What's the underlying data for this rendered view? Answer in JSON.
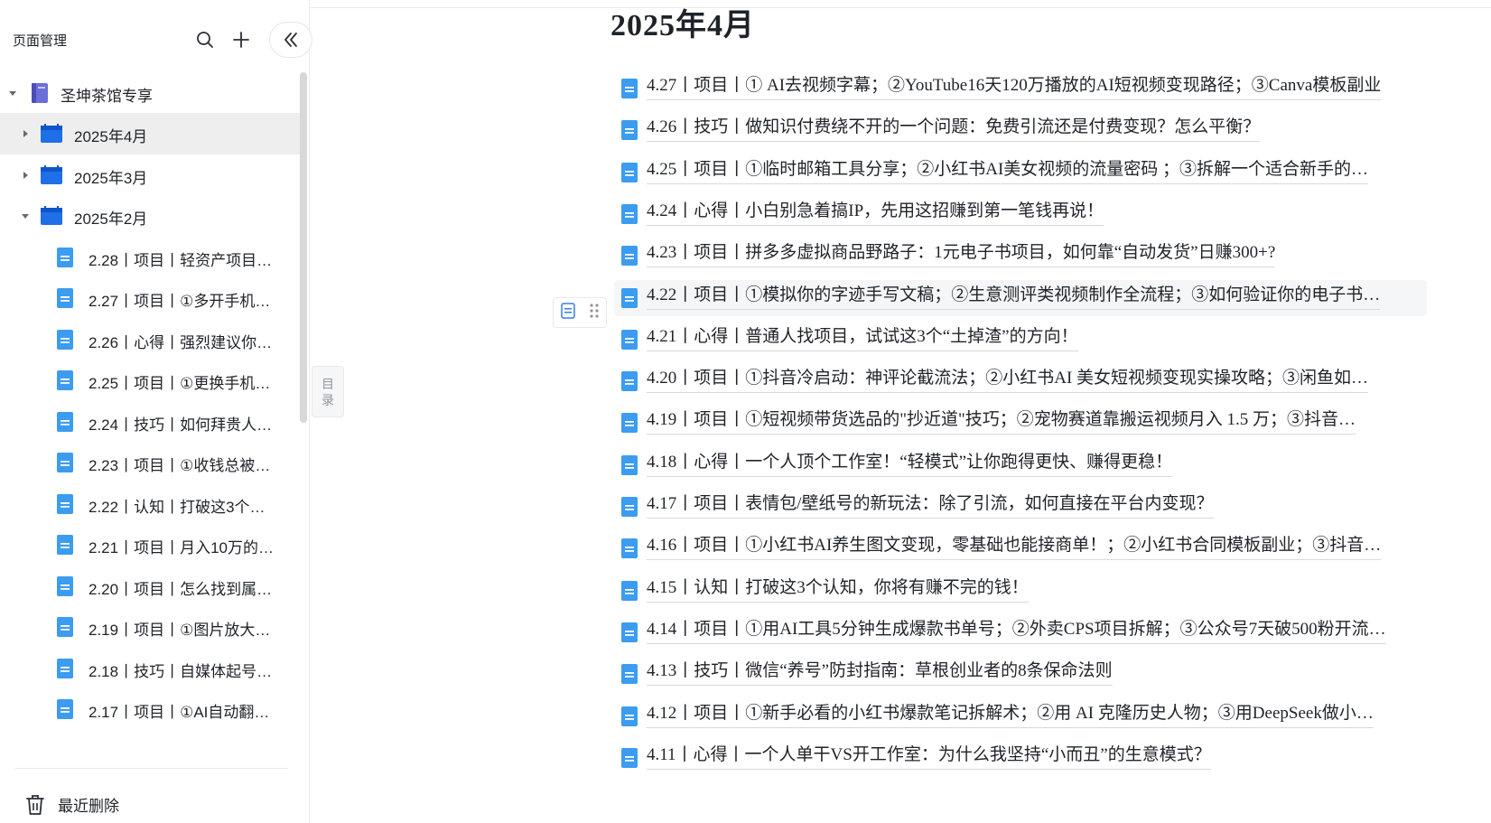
{
  "sidebar": {
    "title": "页面管理",
    "root": {
      "label": "圣坤茶馆专享"
    },
    "folders": [
      {
        "label": "2025年4月"
      },
      {
        "label": "2025年3月"
      },
      {
        "label": "2025年2月"
      }
    ],
    "items": [
      {
        "label": "2.28丨项目丨轻资产项目…"
      },
      {
        "label": "2.27丨项目丨①多开手机…"
      },
      {
        "label": "2.26丨心得丨强烈建议你…"
      },
      {
        "label": "2.25丨项目丨①更换手机…"
      },
      {
        "label": "2.24丨技巧丨如何拜贵人…"
      },
      {
        "label": "2.23丨项目丨①收钱总被…"
      },
      {
        "label": "2.22丨认知丨打破这3个…"
      },
      {
        "label": "2.21丨项目丨月入10万的…"
      },
      {
        "label": "2.20丨项目丨怎么找到属…"
      },
      {
        "label": "2.19丨项目丨①图片放大…"
      },
      {
        "label": "2.18丨技巧丨自媒体起号…"
      },
      {
        "label": "2.17丨项目丨①AI自动翻…"
      }
    ],
    "trash_label": "最近删除",
    "toc_label_1": "目",
    "toc_label_2": "录"
  },
  "main": {
    "title": "2025年4月",
    "docs": [
      {
        "text": "4.27丨项目丨① AI去视频字幕；②YouTube16天120万播放的AI短视频变现路径；③Canva模板副业"
      },
      {
        "text": "4.26丨技巧丨做知识付费绕不开的一个问题：免费引流还是付费变现？怎么平衡？"
      },
      {
        "text": "4.25丨项目丨①临时邮箱工具分享；②小红书AI美女视频的流量密码 ；③拆解一个适合新手的…"
      },
      {
        "text": "4.24丨心得丨小白别急着搞IP，先用这招赚到第一笔钱再说！"
      },
      {
        "text": "4.23丨项目丨拼多多虚拟商品野路子：1元电子书项目，如何靠“自动发货”日赚300+?"
      },
      {
        "text": "4.22丨项目丨①模拟你的字迹手写文稿；②生意测评类视频制作全流程；③如何验证你的电子书…"
      },
      {
        "text": "4.21丨心得丨普通人找项目，试试这3个“土掉渣”的方向！"
      },
      {
        "text": "4.20丨项目丨①抖音冷启动：神评论截流法；②小红书AI 美女短视频变现实操攻略；③闲鱼如…"
      },
      {
        "text": "4.19丨项目丨①短视频带货选品的\"抄近道\"技巧；②宠物赛道靠搬运视频月入 1.5 万；③抖音…"
      },
      {
        "text": "4.18丨心得丨一个人顶个工作室！“轻模式”让你跑得更快、赚得更稳！"
      },
      {
        "text": "4.17丨项目丨表情包/壁纸号的新玩法：除了引流，如何直接在平台内变现？"
      },
      {
        "text": "4.16丨项目丨①小红书AI养生图文变现，零基础也能接商单！；②小红书合同模板副业；③抖音…"
      },
      {
        "text": "4.15丨认知丨打破这3个认知，你将有赚不完的钱！"
      },
      {
        "text": "4.14丨项目丨①用AI工具5分钟生成爆款书单号；②外卖CPS项目拆解；③公众号7天破500粉开流…"
      },
      {
        "text": "4.13丨技巧丨微信“养号”防封指南：草根创业者的8条保命法则"
      },
      {
        "text": "4.12丨项目丨①新手必看的小红书爆款笔记拆解术；②用 AI 克隆历史人物；③用DeepSeek做小…"
      },
      {
        "text": "4.11丨心得丨一个人单干VS开工作室：为什么我坚持“小而丑”的生意模式？"
      }
    ]
  },
  "colors": {
    "doc_icon_blue": "#3b9cf0",
    "folder_blue": "#1e6fe8",
    "book_purple": "#6d6fd9",
    "selected_bg": "#eeeeee"
  },
  "icons": {
    "search": "search-icon",
    "add": "plus-icon",
    "collapse": "double-chevron-left-icon",
    "trash": "trash-icon",
    "doc": "document-icon",
    "folder": "calendar-folder-icon",
    "book": "book-icon"
  }
}
